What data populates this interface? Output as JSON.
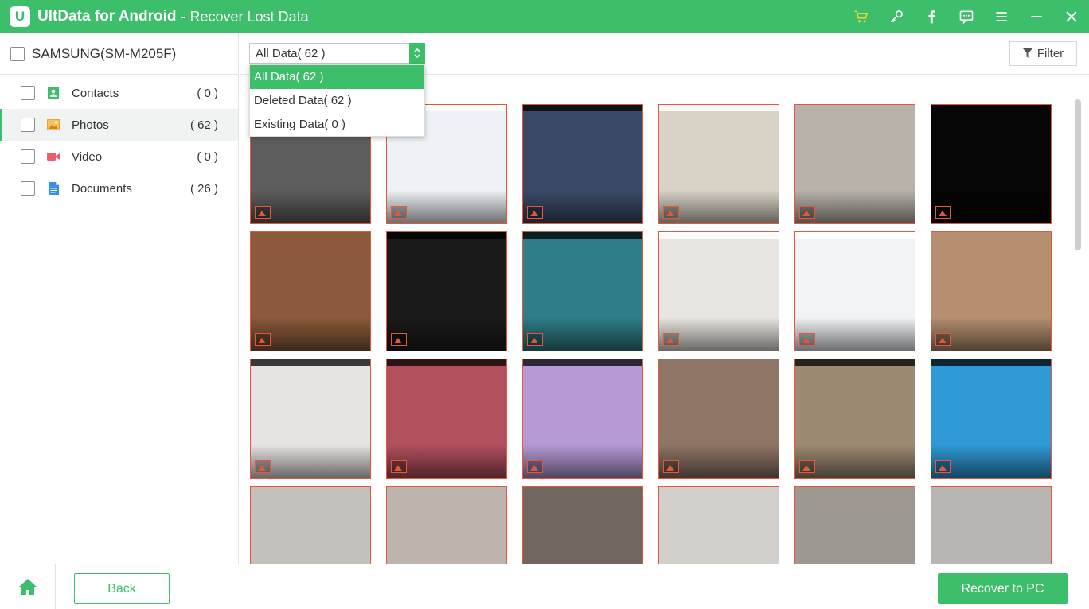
{
  "app": {
    "logo_letter": "U",
    "title": "UltData for Android",
    "subtitle": "- Recover Lost Data",
    "accent_color": "#3dbe6a",
    "highlight_color": "#e2583a"
  },
  "titlebar_icons": [
    "cart-icon",
    "key-icon",
    "facebook-icon",
    "feedback-icon",
    "menu-icon",
    "minimize-icon",
    "close-icon"
  ],
  "sidebar": {
    "device_name": "SAMSUNG(SM-M205F)",
    "categories": [
      {
        "label": "Contacts",
        "count": "( 0 )",
        "icon": "contacts-icon"
      },
      {
        "label": "Photos",
        "count": "( 62 )",
        "icon": "photos-icon",
        "active": true
      },
      {
        "label": "Video",
        "count": "( 0 )",
        "icon": "video-icon"
      },
      {
        "label": "Documents",
        "count": "( 26 )",
        "icon": "documents-icon"
      }
    ]
  },
  "toolbar": {
    "select_value": "All Data( 62 )",
    "filter_label": "Filter"
  },
  "dropdown": {
    "options": [
      "All Data( 62 )",
      "Deleted Data( 62 )",
      "Existing Data( 0 )"
    ],
    "selected_index": 0
  },
  "thumbnails": [
    {
      "bg": "#5d5d5d",
      "bar": "light"
    },
    {
      "bg": "#eef2f6",
      "bar": "light"
    },
    {
      "bg": "#3a4a66",
      "bar": "dark"
    },
    {
      "bg": "#d9d2c6",
      "bar": "light"
    },
    {
      "bg": "#b8b2ab",
      "bar": "none"
    },
    {
      "bg": "#050505",
      "bar": "none"
    },
    {
      "bg": "#8a5a3a",
      "bar": "none"
    },
    {
      "bg": "#1a1a1a",
      "bar": "dark"
    },
    {
      "bg": "#2f7d88",
      "bar": "dark"
    },
    {
      "bg": "#e9e6e1",
      "bar": "light"
    },
    {
      "bg": "#f1f3f7",
      "bar": "light"
    },
    {
      "bg": "#b58f6f",
      "bar": "none"
    },
    {
      "bg": "#e7e3e3",
      "bar": "dark"
    },
    {
      "bg": "#b2505e",
      "bar": "dark"
    },
    {
      "bg": "#b59ad6",
      "bar": "dark"
    },
    {
      "bg": "#8f7566",
      "bar": "none"
    },
    {
      "bg": "#9d8a72",
      "bar": "dark"
    },
    {
      "bg": "#2f9ad6",
      "bar": "dark"
    },
    {
      "bg": "#c4c0bc",
      "bar": "none"
    },
    {
      "bg": "#bdb5ad",
      "bar": "none"
    },
    {
      "bg": "#6f665e",
      "bar": "none"
    },
    {
      "bg": "#d3cfcb",
      "bar": "none"
    },
    {
      "bg": "#9e9892",
      "bar": "none"
    },
    {
      "bg": "#b8b5b2",
      "bar": "none"
    }
  ],
  "footer": {
    "back_label": "Back",
    "recover_label": "Recover to PC"
  }
}
